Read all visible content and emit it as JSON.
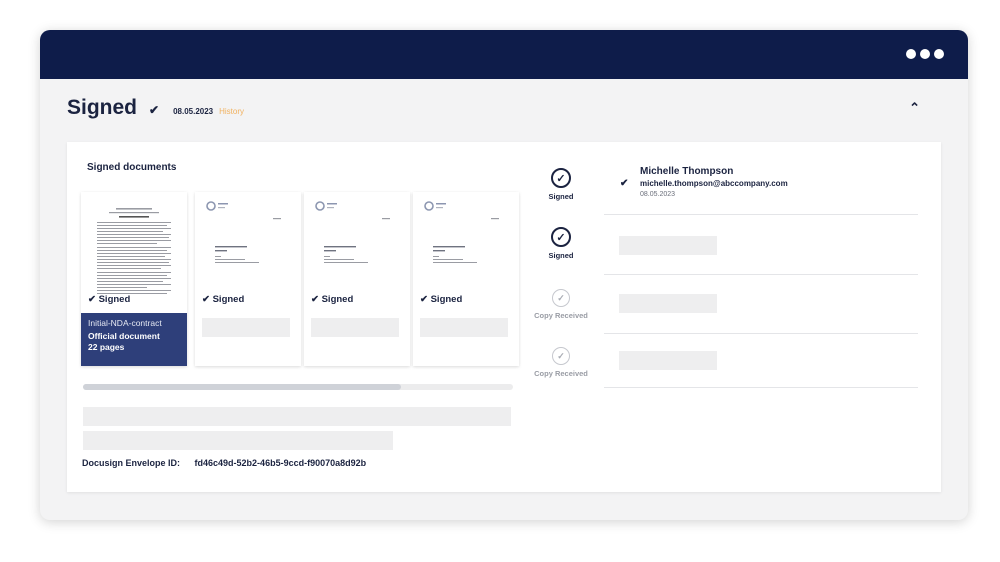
{
  "window": {
    "menu_icon": "ellipsis-icon"
  },
  "header": {
    "status": "Signed",
    "check": "✔",
    "date": "08.05.2023",
    "history": "History",
    "collapse": "⌃"
  },
  "documents": {
    "title": "Signed documents",
    "items": [
      {
        "signed_label": "✔ Signed",
        "name": "Initial-NDA-contract",
        "type": "Official document",
        "pages": "22 pages"
      },
      {
        "signed_label": "✔ Signed"
      },
      {
        "signed_label": "✔ Signed"
      },
      {
        "signed_label": "✔ Signed"
      }
    ],
    "envelope_label": "Docusign Envelope ID:",
    "envelope_id": "fd46c49d-52b2-46b5-9ccd-f90070a8d92b"
  },
  "recipients": [
    {
      "status": "Signed",
      "check": "✔",
      "name": "Michelle Thompson",
      "email": "michelle.thompson@abccompany.com",
      "date": "08.05.2023"
    },
    {
      "status": "Signed"
    },
    {
      "status": "Copy Received"
    },
    {
      "status": "Copy Received"
    }
  ],
  "colors": {
    "titlebar": "#0e1c4a",
    "accent_navy": "#2e3f7a",
    "history": "#f1b260"
  }
}
